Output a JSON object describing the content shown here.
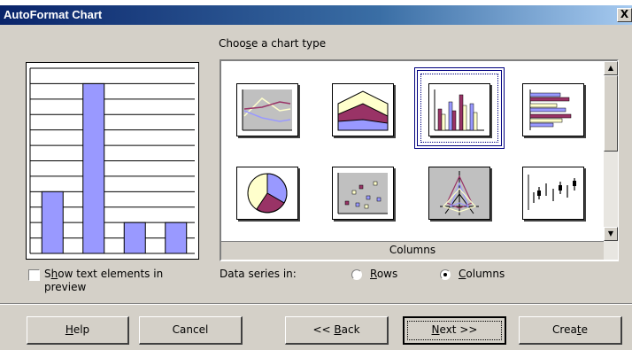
{
  "window": {
    "title": "AutoFormat Chart",
    "close_label": "X"
  },
  "gallery": {
    "heading_pre": "Choo",
    "heading_mnemonic": "s",
    "heading_post": "e a chart type",
    "selected_label": "Columns",
    "selected": "columns",
    "thumbnails": [
      "line-chart-icon",
      "area-chart-icon",
      "column-chart-icon",
      "bar-chart-icon",
      "pie-chart-icon",
      "scatter-chart-icon",
      "radar-chart-icon",
      "stock-chart-icon"
    ]
  },
  "preview": {
    "chart_data": {
      "type": "bar",
      "values": [
        4,
        11,
        2,
        2
      ],
      "ylim": [
        0,
        12
      ],
      "color": "#9999ff"
    }
  },
  "options": {
    "show_text_pre": "S",
    "show_text_mnemonic": "h",
    "show_text_post": "ow text elements in",
    "show_text_line2": "preview",
    "show_text_checked": false,
    "data_series_label": "Data series in:",
    "rows_mnemonic": "R",
    "rows_post": "ows",
    "columns_mnemonic": "C",
    "columns_post": "olumns",
    "selected_series": "columns"
  },
  "buttons": {
    "help_mnemonic": "H",
    "help_post": "elp",
    "cancel": "Cancel",
    "back_pre": "<< ",
    "back_mnemonic": "B",
    "back_post": "ack",
    "next_mnemonic": "N",
    "next_post": "ext >>",
    "create_pre": "Crea",
    "create_mnemonic": "t",
    "create_post": "e"
  },
  "colors": {
    "titlebar": "#0a246a",
    "face": "#d4d0c8",
    "selection": "#00007f",
    "series_periwinkle": "#9999ff",
    "series_plum": "#993366",
    "series_ivory": "#ffffcc"
  }
}
